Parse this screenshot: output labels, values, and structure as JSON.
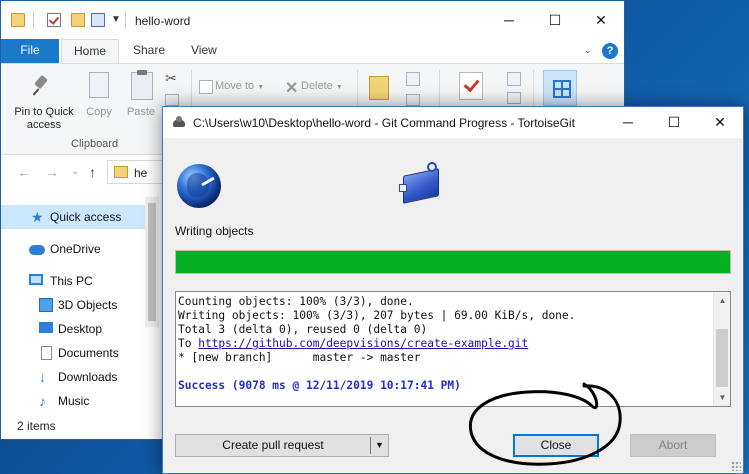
{
  "explorer": {
    "title": "hello-word",
    "tabs": [
      "File",
      "Home",
      "Share",
      "View"
    ],
    "ribbon": {
      "pin_label": "Pin to Quick",
      "pin_label2": "access",
      "copy_label": "Copy",
      "paste_label": "Paste",
      "moveto_label": "Move to",
      "delete_label": "Delete",
      "clipboard_group": "Clipboard"
    },
    "address_fragment": "he",
    "nav_items": [
      "Quick access",
      "OneDrive",
      "This PC",
      "3D Objects",
      "Desktop",
      "Documents",
      "Downloads",
      "Music"
    ],
    "status": "2 items"
  },
  "dialog": {
    "title": "C:\\Users\\w10\\Desktop\\hello-word - Git Command Progress - TortoiseGit",
    "status_label": "Writing objects",
    "progress": 1.0,
    "progress_color": "#06b025",
    "log": {
      "line1": "Counting objects: 100% (3/3), done.",
      "line2": "Writing objects: 100% (3/3), 207 bytes | 69.00 KiB/s, done.",
      "line3": "Total 3 (delta 0), reused 0 (delta 0)",
      "line4_prefix": "To ",
      "line4_link": "https://github.com/deepvisions/create-example.git",
      "line5": "* [new branch]      master -> master",
      "success": "Success (9078 ms @ 12/11/2019 10:17:41 PM)"
    },
    "buttons": {
      "create_pr": "Create pull request",
      "close": "Close",
      "abort": "Abort"
    }
  },
  "icons": {
    "window_minimize": "─",
    "window_maximize": "☐",
    "window_close": "✕",
    "dropdown": "▼",
    "nav_back": "←",
    "nav_forward": "→",
    "nav_up": "↑",
    "chevron_down": "⌄",
    "scroll_up": "▲",
    "scroll_down": "▼",
    "cut": "✂",
    "delete": "✕",
    "star": "★",
    "download": "↓",
    "music": "♪",
    "help": "?"
  },
  "colors": {
    "accent": "#1979ca",
    "annotation": "#000000"
  }
}
